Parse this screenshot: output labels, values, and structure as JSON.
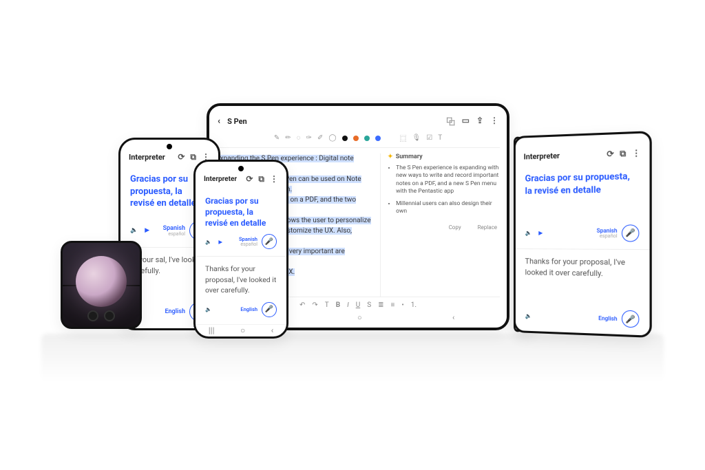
{
  "interpreter": {
    "title": "Interpreter",
    "top": {
      "text": "Gracias por su propuesta, la revisé en detalle",
      "lang": "Spanish",
      "lang_sub": "español"
    },
    "bottom": {
      "text_short": "Thanks for your proposal, I've looked it over carefully.",
      "text_wrapped": "Thanks for your proposal, I've looked it over carefully.",
      "text_frag": "or your sal, I've looked carefully.",
      "lang": "English"
    },
    "icons": {
      "history": "history-icon",
      "screen": "screen-icon",
      "more": "more-icon",
      "speaker": "speaker-icon",
      "play": "play-icon",
      "mic": "mic-icon"
    }
  },
  "tablet": {
    "title": "S Pen",
    "colors": {
      "accent": "#3b6cff",
      "orange": "#e86c28",
      "teal": "#2aa69a",
      "black": "#111"
    },
    "note_lines": [
      "Expanding the S Pen experience : Digital note taking experience and",
      "customizing UX The S Pen can be used on Note with even more freedom.",
      "be written and recorded on a PDF, and the two contents",
      "app called Pentastic allows the user to personalize",
      "s that they want and customize the UX. Also, millennial",
      "rsonal expression to be very important are afforded",
      "gning their own S Pen UX."
    ],
    "summary": {
      "title": "Summary",
      "bullets": [
        "The S Pen experience is expanding with new ways to write and record important notes on a PDF, and a new S Pen menu with the Pentastic app",
        "Millennial users can also design their own"
      ]
    },
    "bottom_actions": {
      "copy": "Copy",
      "replace": "Replace"
    },
    "edit_tools": [
      "↶",
      "↷",
      "T",
      "B",
      "I",
      "U",
      "S",
      "≣",
      "≡",
      "≣",
      "☰",
      "•",
      "1."
    ]
  },
  "fold": {
    "bottom_text": "Thanks for your proposal, I've looked it over carefully."
  }
}
